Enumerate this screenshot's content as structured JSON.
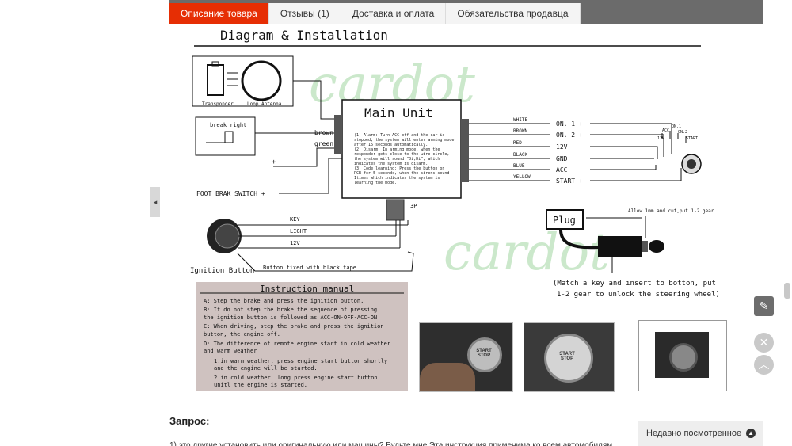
{
  "tabs": [
    {
      "label": "Описание товара",
      "active": true
    },
    {
      "label": "Отзывы (1)",
      "active": false
    },
    {
      "label": "Доставка и оплата",
      "active": false
    },
    {
      "label": "Обязательства продавца",
      "active": false
    }
  ],
  "diagram": {
    "title": "Diagram & Installation",
    "watermark": "cardot",
    "transponder": "Transponder",
    "loop_antenna": "Loop Antenna",
    "break_right": "break right",
    "wire_brown_in": "brown",
    "wire_green_in": "green",
    "plus": "+",
    "foot_brake": "FOOT BRAK SWITCH +",
    "main_unit": "Main Unit",
    "main_text": [
      "(1) Alarm: Turn ACC off and the car is stopped, the system will enter arming mode after 15 seconds automatically.",
      "(2) Disarm: In arming mode, when the responder gets close to the wire circle, the system will sound \"Di,Di\", which indicates the system is disarm.",
      "(3) Code learning: Press the button on PCB for 5 seconds, when the sirens sound 1times which indicates the system is learning the mode."
    ],
    "connector_3p": "3P",
    "wires": [
      "WHITE",
      "BROWN",
      "RED",
      "BLACK",
      "BLUE",
      "YELLOW"
    ],
    "terminals": [
      "ON. 1 +",
      "ON. 2 +",
      "12V +",
      "GND",
      "ACC +",
      "START +"
    ],
    "switch_labels": [
      "ACC",
      "ON.1",
      "ON.2",
      "12V",
      "START"
    ],
    "ign_wires": [
      "KEY",
      "LIGHT",
      "12V"
    ],
    "ignition_button": "Ignition Button",
    "button_fixed": "Button fixed with black tape",
    "plug": "Plug",
    "allow_note": "Allow 1mm and cut,put 1-2 gear",
    "match_key": "(Match a key and insert to botton, put 1-2 gear to unlock the steering wheel)"
  },
  "manual": {
    "title": "Instruction manual",
    "lines": [
      "A: Step the brake and press the ignition button.",
      "B: If do not step the brake  the sequence of pressing",
      "   the ignition button is followed as ACC-ON-OFF-ACC-ON",
      "C: When driving, step the brake and press the ignition",
      "   button, the engine off.",
      "D: The difference of remote engine start in cold weather",
      "   and warm weather",
      "1.in warm weather, press engine start button shortly",
      "  and the engine will be started.",
      "2.in cold weather, long press engine start button",
      "  unitl the engine is started."
    ]
  },
  "photos": {
    "start_stop_1": "START STOP",
    "start_stop_2": "START STOP"
  },
  "page": {
    "query_label": "Запрос:",
    "query_text": "1) это другие установить или оригинальную или машины? Будьте мне Эта инструкция применима ко всем автомобилям",
    "recently_viewed": "Недавно посмотренное"
  },
  "icons": {
    "collapse": "chevron-left-icon",
    "edit": "pencil-icon",
    "close": "close-icon",
    "up": "chevron-up-icon"
  },
  "colors": {
    "tab_active": "#e62e04",
    "topstrip": "#6b6b6b",
    "manual_bg": "#cfc2c0",
    "watermark": "#bfe3bf"
  }
}
